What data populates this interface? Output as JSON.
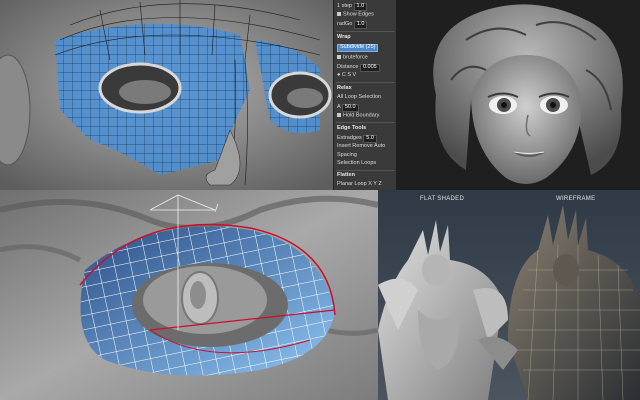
{
  "tool_panel": {
    "rows": [
      {
        "kind": "field",
        "label": "1 step",
        "value": "1.0"
      },
      {
        "kind": "check",
        "label": "Show Edges"
      },
      {
        "kind": "field",
        "label": "radGo",
        "value": "1.0"
      },
      {
        "kind": "section",
        "label": "Wrap"
      },
      {
        "kind": "button_active",
        "label": "Subdivide (25)"
      },
      {
        "kind": "check",
        "label": "bruteforce"
      },
      {
        "kind": "field",
        "label": "Distance",
        "value": "0.005"
      },
      {
        "kind": "text",
        "label": "●  C  S  V"
      },
      {
        "kind": "section",
        "label": "Relax"
      },
      {
        "kind": "text",
        "label": "All  Loop  Selection"
      },
      {
        "kind": "field",
        "label": "A",
        "value": "50.0"
      },
      {
        "kind": "check",
        "label": "Hold Boundary"
      },
      {
        "kind": "section",
        "label": "Edge Tools"
      },
      {
        "kind": "field",
        "label": "Extradges",
        "value": "5.0"
      },
      {
        "kind": "text",
        "label": "Insert  Remove  Auto"
      },
      {
        "kind": "text",
        "label": "Spacing"
      },
      {
        "kind": "text",
        "label": "Selection  Loops"
      },
      {
        "kind": "section",
        "label": "Flatten"
      },
      {
        "kind": "text",
        "label": "Planar Loop  X  Y  Z"
      }
    ]
  },
  "captions": {
    "flat_shaded": "FLAT SHADED",
    "wireframe": "WIREFRAME"
  },
  "colors": {
    "retopo_blue": "#4a90d9",
    "sculpt_grey": "#8c8c8c",
    "curve_red": "#c8102e"
  }
}
